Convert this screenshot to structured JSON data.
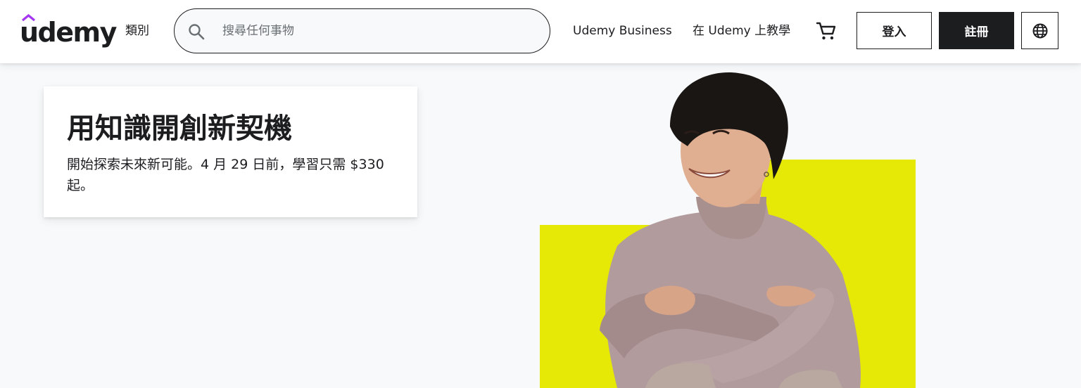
{
  "header": {
    "logo_text": "udemy",
    "categories_label": "類別",
    "search": {
      "placeholder": "搜尋任何事物",
      "value": ""
    },
    "business_link": "Udemy Business",
    "teach_link": "在 Udemy 上教學",
    "login_label": "登入",
    "signup_label": "註冊"
  },
  "hero": {
    "title": "用知識開創新契機",
    "body": "開始探索未來新可能。4 月 29 日前，學習只需 $330起。"
  },
  "colors": {
    "brand_purple": "#a435f0",
    "dark": "#1c1d1f",
    "hero_yellow": "#e6e805",
    "sweater": "#b29b9d"
  },
  "icons": [
    "udemy-logo",
    "search-icon",
    "cart-icon",
    "globe-icon"
  ]
}
